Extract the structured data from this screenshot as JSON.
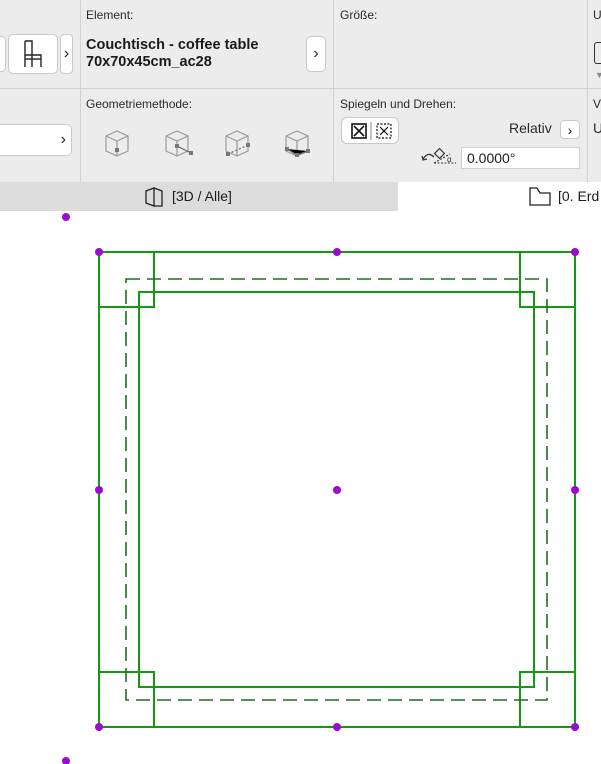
{
  "toolbar": {
    "element_label": "Element:",
    "element_name_line1": "Couchtisch - coffee table",
    "element_name_line2": "70x70x45cm_ac28",
    "size_label": "Größe:",
    "cut_label_1": "U",
    "geometry_label": "Geometriemethode:",
    "mirror_label": "Spiegeln und Drehen:",
    "relative_label": "Relativ",
    "angle_value": "0.0000°",
    "cut_label_2": "V",
    "cut_value_2": "U"
  },
  "tabs": {
    "left_label": "[3D / Alle]",
    "right_label": "[0. Erd"
  },
  "colors": {
    "toolbar_bg": "#ececec",
    "furniture_line": "#129a12",
    "hotspot": "#9b0ad0"
  },
  "icons": [
    "chair-icon",
    "chevron-right-icon",
    "geometry-box-icon",
    "mirror-icon",
    "rotate-angle-icon",
    "view-3d-icon",
    "floor-plan-icon"
  ]
}
